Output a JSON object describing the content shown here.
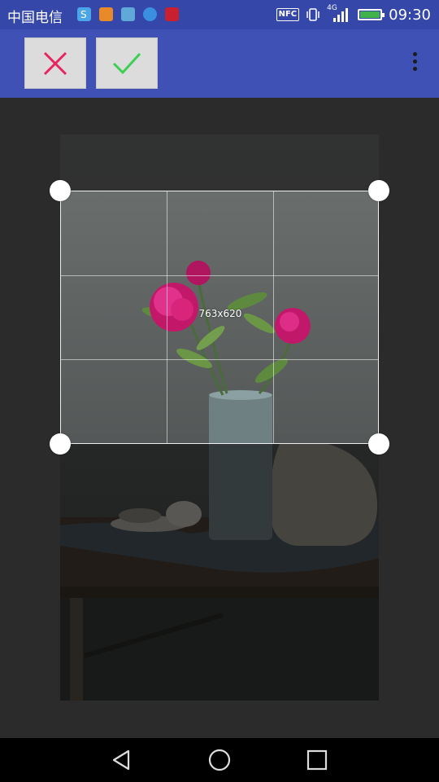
{
  "status_bar": {
    "carrier": "中国电信",
    "nfc_label": "NFC",
    "network": "4G",
    "time": "09:30",
    "icon_names": [
      "skype-icon",
      "taobao-icon",
      "android-icon",
      "message-icon",
      "huawei-icon",
      "nfc-icon",
      "vibrate-icon",
      "signal-icon",
      "battery-icon"
    ]
  },
  "toolbar": {
    "cancel_icon": "close-icon",
    "confirm_icon": "check-icon",
    "overflow_icon": "more-vert-icon",
    "colors": {
      "bar": "#3f51b5",
      "cancel": "#e8245f",
      "confirm": "#3ccf52"
    }
  },
  "crop": {
    "dimensions_label": "763x620"
  },
  "nav_bar": {
    "back_icon": "back-triangle-icon",
    "home_icon": "home-circle-icon",
    "recents_icon": "recents-square-icon"
  }
}
